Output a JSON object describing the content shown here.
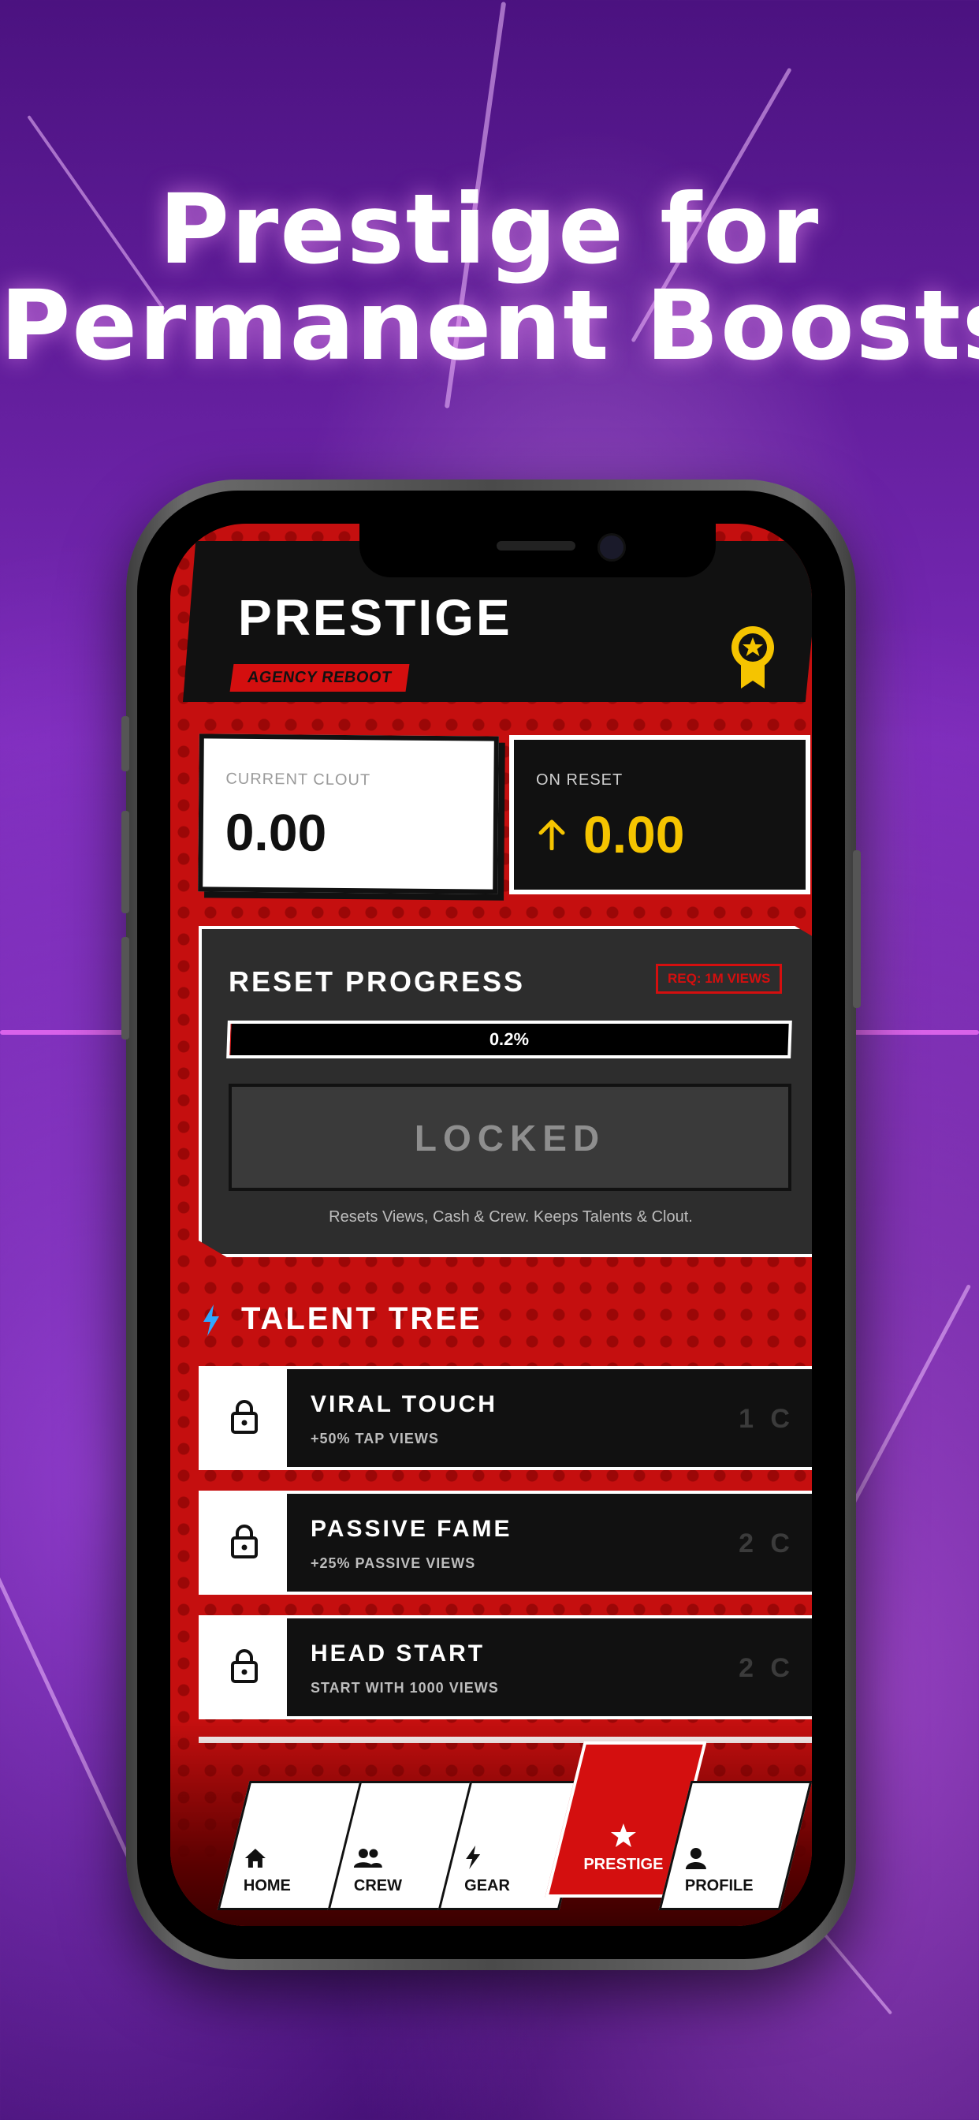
{
  "promo": {
    "headline_line1": "Prestige for",
    "headline_line2": "Permanent Boosts"
  },
  "header": {
    "title": "PRESTIGE",
    "subtitle": "AGENCY REBOOT",
    "badge_icon": "award-medal-icon"
  },
  "stats": {
    "current_clout_label": "CURRENT CLOUT",
    "current_clout_value": "0.00",
    "on_reset_label": "ON RESET",
    "on_reset_value": "0.00",
    "on_reset_icon": "arrow-up-icon"
  },
  "reset_progress": {
    "title": "RESET PROGRESS",
    "requirement": "REQ: 1M VIEWS",
    "progress_text": "0.2%",
    "progress_fraction": 0.002,
    "button_label": "LOCKED",
    "note": "Resets Views, Cash & Crew. Keeps Talents & Clout."
  },
  "talent_tree": {
    "title": "TALENT TREE",
    "icon": "lightning-icon",
    "items": [
      {
        "name": "VIRAL TOUCH",
        "desc": "+50% TAP VIEWS",
        "cost": "1 C",
        "icon": "lock-icon"
      },
      {
        "name": "PASSIVE FAME",
        "desc": "+25% PASSIVE VIEWS",
        "cost": "2 C",
        "icon": "lock-icon"
      },
      {
        "name": "HEAD START",
        "desc": "START WITH 1000 VIEWS",
        "cost": "2 C",
        "icon": "lock-icon"
      }
    ]
  },
  "nav": {
    "tabs": [
      {
        "label": "HOME",
        "icon": "home-icon"
      },
      {
        "label": "CREW",
        "icon": "users-icon"
      },
      {
        "label": "GEAR",
        "icon": "lightning-icon"
      },
      {
        "label": "PRESTIGE",
        "icon": "star-icon",
        "active": true
      },
      {
        "label": "PROFILE",
        "icon": "user-icon"
      }
    ]
  },
  "colors": {
    "accent_red": "#d40f0f",
    "gold": "#f5c400",
    "cyan": "#2fa8ff",
    "background_purple": "#6a1fa8"
  }
}
